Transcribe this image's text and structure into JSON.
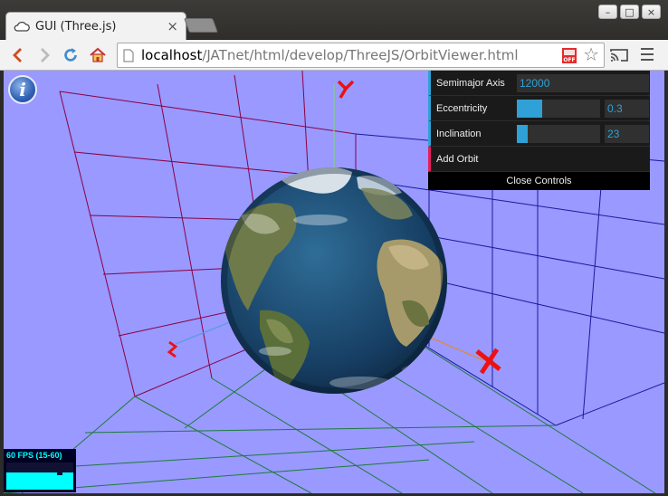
{
  "browser": {
    "tab_title": "GUI (Three.js)",
    "tab_close": "×",
    "url_host": "localhost",
    "url_path": "/JATnet/html/develop/ThreeJS/OrbitViewer.html",
    "off_badge": "OFF",
    "window_buttons": {
      "minimize": "–",
      "maximize": "□",
      "close": "×"
    }
  },
  "viewer": {
    "info_label": "i",
    "axis_labels": {
      "x": "X",
      "y": "Y",
      "z": "Z"
    }
  },
  "gui": {
    "controls": [
      {
        "label": "Semimajor Axis",
        "value": "12000"
      },
      {
        "label": "Eccentricity",
        "value": "0.3",
        "fraction": 0.3
      },
      {
        "label": "Inclination",
        "value": "23",
        "fraction": 0.128
      }
    ],
    "add_orbit_label": "Add Orbit",
    "close_label": "Close Controls"
  },
  "stats": {
    "fps_text": "60 FPS (15-60)",
    "level": 0.62
  },
  "colors": {
    "background": "#9999ff",
    "grid_back": "#8b0045",
    "grid_side": "#1a1aa0",
    "grid_floor": "#1e7a3a",
    "axis_y": "#7ccf7c",
    "axis_x": "#e08a3a",
    "axis_z": "#5a9de0",
    "label_red": "#ee1111",
    "ocean": "#143d5e",
    "gui_accent": "#2fa1d6",
    "gui_function": "#e61d5f"
  }
}
